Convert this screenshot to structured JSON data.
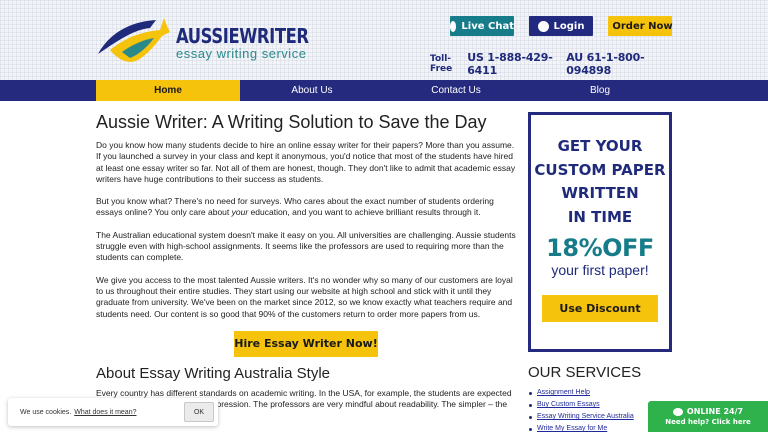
{
  "brand": {
    "name": "AUSSIEWRITER",
    "tagline": "essay writing service"
  },
  "top_buttons": {
    "live_chat": "Live Chat",
    "login": "Login",
    "order_now": "Order Now"
  },
  "phones": {
    "toll_free_label": "Toll-Free",
    "us": "US 1-888-429-6411",
    "au": "AU 61-1-800-094898"
  },
  "nav": {
    "items": [
      {
        "label": "Home"
      },
      {
        "label": "About Us"
      },
      {
        "label": "Contact Us"
      },
      {
        "label": "Blog"
      }
    ]
  },
  "article": {
    "title": "Aussie Writer: A Writing Solution to Save the Day",
    "p1": "Do you know how many students decide to hire an online essay writer for their papers? More than you assume. If you launched a survey in your class and kept it anonymous, you'd notice that most of the students have hired at least one essay writer so far. Not all of them are honest, though. They don't like to admit that academic essay writers have huge contributions to their success as students.",
    "p2_start": "But you know what? There's no need for surveys. Who cares about the exact number of students ordering essays online? You only care about ",
    "p2_em": "your",
    "p2_end": " education, and you want to achieve brilliant results through it.",
    "p3": "The Australian educational system doesn't make it easy on you. All universities are challenging. Aussie students struggle even with high-school assignments. It seems like the professors are used to requiring more than the students can complete.",
    "p4": "We give you access to the most talented Aussie writers. It's no wonder why so many of our customers are loyal to us throughout their entire studies. They start using our website at high school and stick with it until they graduate from university. We've been on the market since 2012, so we know exactly what teachers require and students need. Our content is so good that 90% of the customers return to order more papers from us.",
    "cta": "Hire Essay Writer Now!",
    "subtitle": "About Essay Writing Australia Style",
    "p5": "Every country has different standards on academic writing. In the USA, for example, the students are expected to use a sophisticated way of expression. The professors are very mindful about readability. The simpler – the better."
  },
  "promo": {
    "line1": "GET YOUR",
    "line2": "CUSTOM PAPER",
    "line3": "WRITTEN",
    "line4": "IN TIME",
    "discount": "18%OFF",
    "sub": "your first paper!",
    "button": "Use Discount"
  },
  "services": {
    "title": "OUR SERVICES",
    "items": [
      "Assignment Help",
      "Buy Custom Essays",
      "Essay Writing Service Australia",
      "Write My Essay for Me"
    ]
  },
  "cookie": {
    "text": "We use cookies.",
    "link": "What does it mean?",
    "ok": "OK"
  },
  "chat_widget": {
    "title": "ONLINE 24/7",
    "sub": "Need help? Click here"
  },
  "colors": {
    "navy": "#252a7e",
    "yellow": "#f5c20c",
    "teal": "#177c8a",
    "green": "#2fb24c"
  }
}
